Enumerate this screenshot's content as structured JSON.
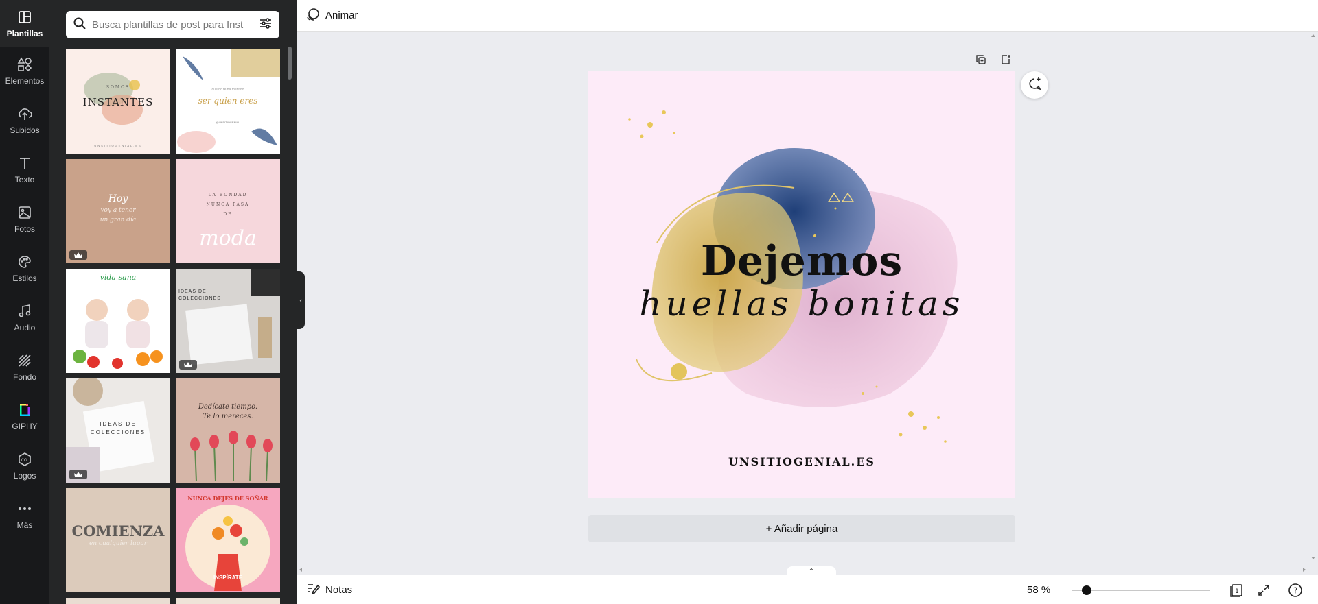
{
  "rail": {
    "items": [
      {
        "label": "Plantillas",
        "icon": "templates-icon"
      },
      {
        "label": "Elementos",
        "icon": "elements-icon"
      },
      {
        "label": "Subidos",
        "icon": "upload-cloud-icon"
      },
      {
        "label": "Texto",
        "icon": "text-icon"
      },
      {
        "label": "Fotos",
        "icon": "photo-icon"
      },
      {
        "label": "Estilos",
        "icon": "palette-icon"
      },
      {
        "label": "Audio",
        "icon": "music-note-icon"
      },
      {
        "label": "Fondo",
        "icon": "background-pattern-icon"
      },
      {
        "label": "GIPHY",
        "icon": "giphy-icon"
      },
      {
        "label": "Logos",
        "icon": "logo-icon"
      },
      {
        "label": "Más",
        "icon": "more-dots-icon"
      }
    ]
  },
  "search": {
    "placeholder": "Busca plantillas de post para Inst"
  },
  "templates": [
    {
      "text1": "SOMOS",
      "text2": "INSTANTES",
      "text3": "UNSITIOGENIAL.ES",
      "premium": false
    },
    {
      "text1": "que no te ha mentido",
      "text2": "ser quien eres",
      "text3": "@UNSITIOGENIAL",
      "premium": false
    },
    {
      "text1": "Hoy",
      "text2": "voy a tener",
      "text3": "un gran día",
      "premium": true
    },
    {
      "text1": "LA BONDAD NUNCA PASA DE",
      "text2": "moda",
      "text3": "",
      "premium": false
    },
    {
      "text1": "vida sana",
      "text2": "",
      "text3": "",
      "premium": false
    },
    {
      "text1": "IDEAS DE",
      "text2": "COLECCIONES",
      "text3": "",
      "premium": true
    },
    {
      "text1": "IDEAS DE",
      "text2": "COLECCIONES",
      "text3": "",
      "premium": true
    },
    {
      "text1": "Dedícate tiempo.",
      "text2": "Te lo mereces.",
      "text3": "",
      "premium": false
    },
    {
      "text1": "COMIENZA",
      "text2": "en cualquier lugar",
      "text3": "",
      "premium": false
    },
    {
      "text1": "NUNCA DEJES DE SOÑAR",
      "text2": "INSPÍRATE",
      "text3": "",
      "premium": false
    }
  ],
  "topbar": {
    "animate_label": "Animar"
  },
  "design": {
    "headline": "Dejemos",
    "subline": "huellas bonitas",
    "site": "UNSITIOGENIAL.ES",
    "background_color": "#fdebf8"
  },
  "add_page_label": "+ Añadir página",
  "bottombar": {
    "notes_label": "Notas",
    "zoom_label": "58 %",
    "zoom_percent": 58,
    "page_count": "1",
    "help": "?"
  },
  "colors": {
    "rail_bg": "#18191b",
    "panel_bg": "#252627",
    "workspace_bg": "#ebecf0"
  }
}
